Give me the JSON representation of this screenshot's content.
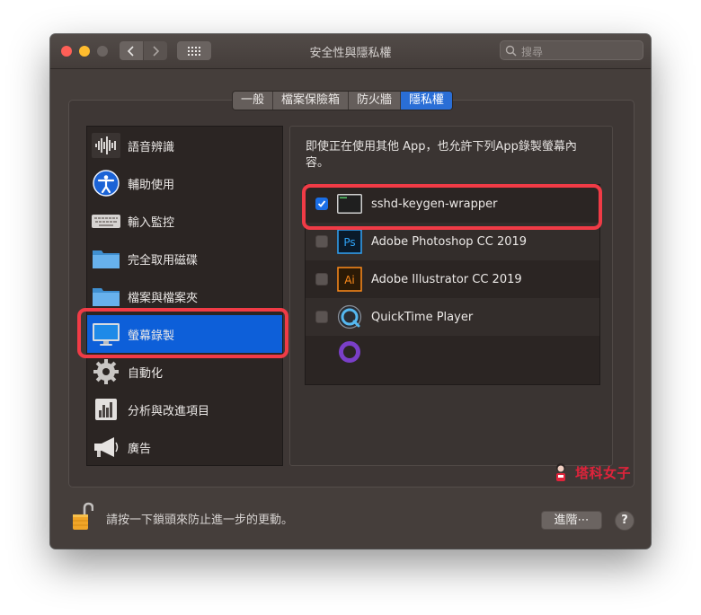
{
  "window": {
    "title": "安全性與隱私權"
  },
  "search": {
    "placeholder": "搜尋"
  },
  "tabs": [
    {
      "label": "一般",
      "active": false
    },
    {
      "label": "檔案保險箱",
      "active": false
    },
    {
      "label": "防火牆",
      "active": false
    },
    {
      "label": "隱私權",
      "active": true
    }
  ],
  "sidebar": {
    "items": [
      {
        "label": "語音辨識",
        "icon": "waveform-icon"
      },
      {
        "label": "輔助使用",
        "icon": "accessibility-icon"
      },
      {
        "label": "輸入監控",
        "icon": "keyboard-icon"
      },
      {
        "label": "完全取用磁碟",
        "icon": "folder-icon"
      },
      {
        "label": "檔案與檔案夾",
        "icon": "folder-icon"
      },
      {
        "label": "螢幕錄製",
        "icon": "monitor-icon",
        "selected": true
      },
      {
        "label": "自動化",
        "icon": "gear-icon"
      },
      {
        "label": "分析與改進項目",
        "icon": "chart-icon"
      },
      {
        "label": "廣告",
        "icon": "megaphone-icon"
      }
    ]
  },
  "content": {
    "description": "即使正在使用其他 App，也允許下列App錄製螢幕內容。",
    "apps": [
      {
        "name": "sshd-keygen-wrapper",
        "checked": true,
        "icon": "terminal-icon"
      },
      {
        "name": "Adobe Photoshop CC 2019",
        "checked": false,
        "icon": "photoshop-icon",
        "badge": "Ps"
      },
      {
        "name": "Adobe Illustrator CC 2019",
        "checked": false,
        "icon": "illustrator-icon",
        "badge": "Ai"
      },
      {
        "name": "QuickTime Player",
        "checked": false,
        "icon": "quicktime-icon"
      }
    ]
  },
  "footer": {
    "lock_text": "請按一下鎖頭來防止進一步的更動。",
    "advanced_label": "進階⋯",
    "help_label": "?"
  },
  "watermark": {
    "text": "塔科女子"
  },
  "colors": {
    "accent": "#0d5fd9",
    "highlight": "#f03b46",
    "watermark": "#e0233b"
  }
}
